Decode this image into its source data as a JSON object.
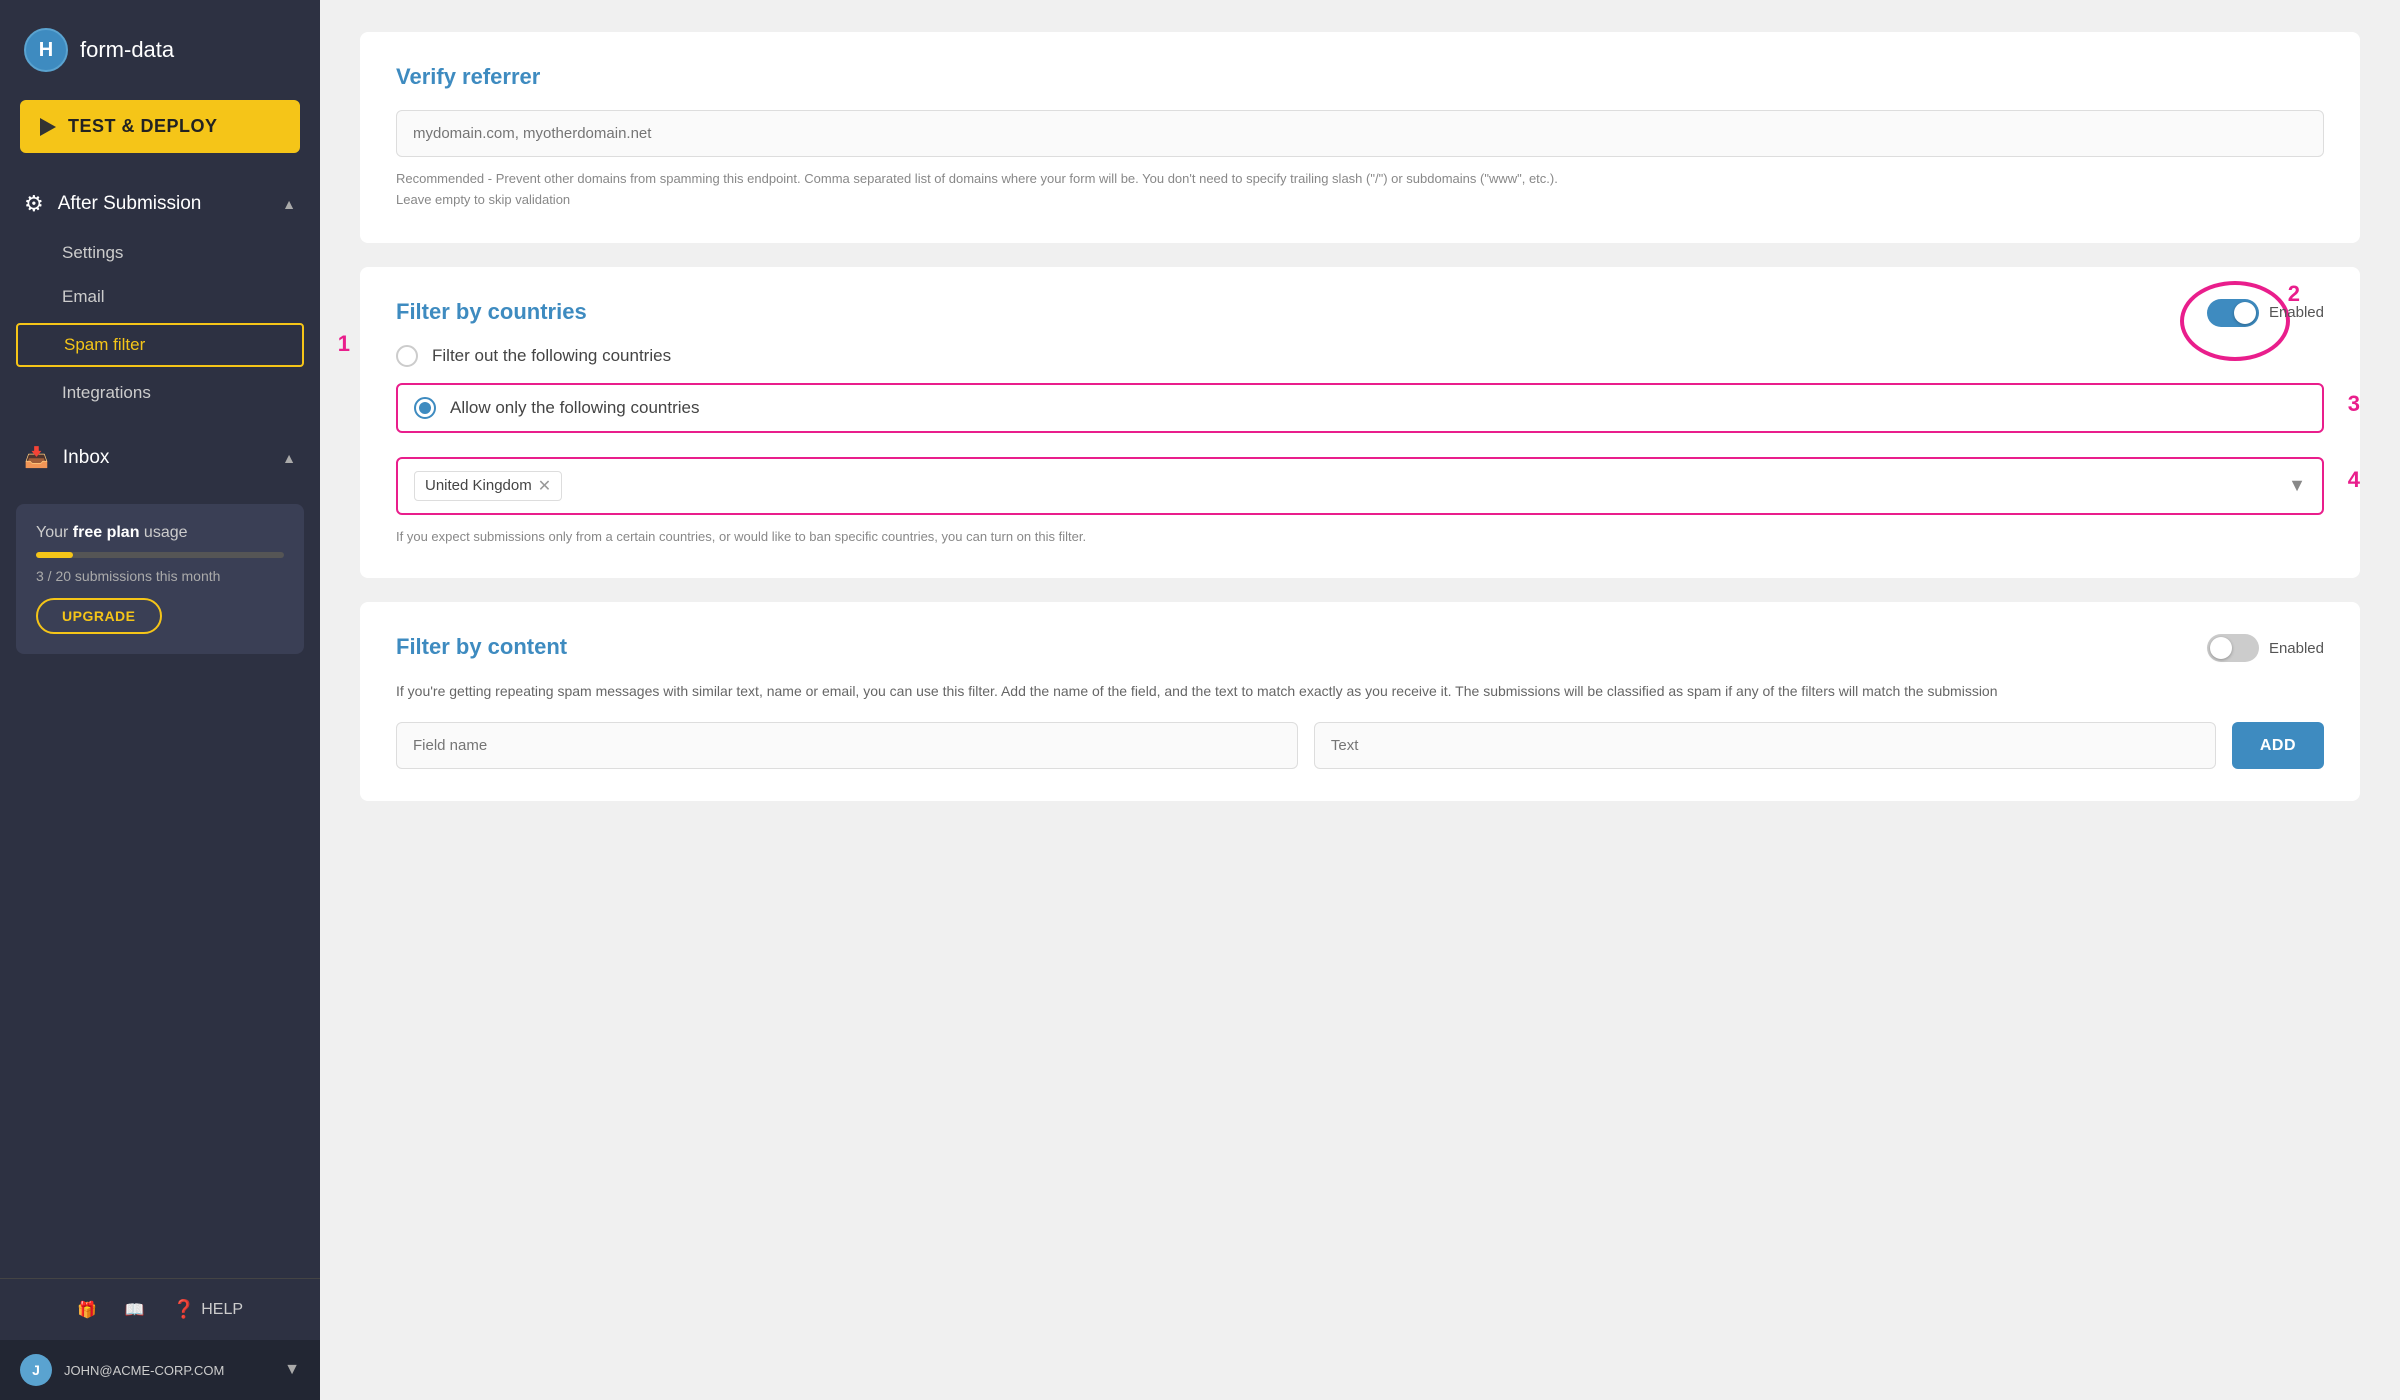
{
  "app": {
    "logo_letter": "H",
    "logo_name": "form-data"
  },
  "sidebar": {
    "deploy_button": "TEST & DEPLOY",
    "after_submission": {
      "label": "After Submission",
      "items": [
        "Settings",
        "Email",
        "Spam filter",
        "Integrations"
      ]
    },
    "inbox": {
      "label": "Inbox"
    },
    "plan": {
      "text": "Your ",
      "plan_type": "free plan",
      "text2": " usage",
      "count": "3 / 20 submissions this month",
      "upgrade": "UPGRADE"
    },
    "help": "HELP",
    "user_email": "JOHN@ACME-CORP.COM"
  },
  "main": {
    "verify_referrer": {
      "title": "Verify referrer",
      "placeholder": "mydomain.com, myotherdomain.net",
      "help": "Recommended - Prevent other domains from spamming this endpoint. Comma separated list of domains where your form will be. You don't need to specify trailing slash (\"/\") or subdomains (\"www\", etc.).\nLeave empty to skip validation"
    },
    "filter_countries": {
      "title": "Filter by countries",
      "enabled": true,
      "toggle_label": "Enabled",
      "options": [
        {
          "label": "Filter out the following countries",
          "selected": false
        },
        {
          "label": "Allow only the following countries",
          "selected": true
        }
      ],
      "selected_countries": [
        "United Kingdom"
      ],
      "help": "If you expect submissions only from a certain countries, or would like to ban specific countries, you can turn on this filter."
    },
    "filter_content": {
      "title": "Filter by content",
      "enabled": false,
      "toggle_label": "Enabled",
      "help": "If you're getting repeating spam messages with similar text, name or email, you can use this filter. Add the name of the field, and the text to match exactly as you receive it. The submissions will be classified as spam if any of the filters will match the submission",
      "field_name_placeholder": "Field name",
      "text_placeholder": "Text",
      "add_button": "ADD"
    }
  },
  "annotations": {
    "1": "1",
    "2": "2",
    "3": "3",
    "4": "4"
  }
}
